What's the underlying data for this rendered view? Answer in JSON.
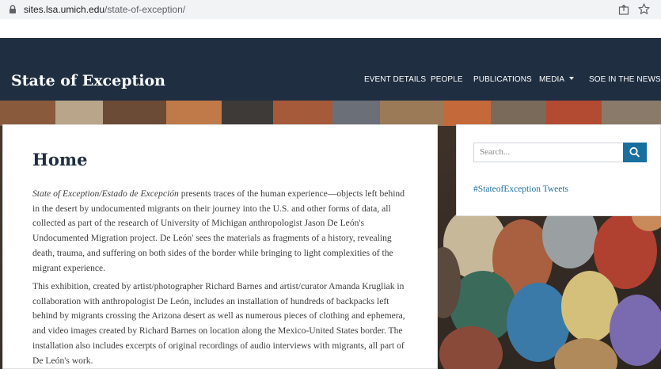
{
  "browser": {
    "url_host": "sites.lsa.umich.edu",
    "url_path": "/state-of-exception/"
  },
  "site": {
    "title": "State of Exception",
    "nav": [
      {
        "label": "EVENT DETAILS"
      },
      {
        "label": "PEOPLE"
      },
      {
        "label": "PUBLICATIONS"
      },
      {
        "label": "MEDIA"
      },
      {
        "label": "SOE IN THE NEWS"
      }
    ]
  },
  "main": {
    "title": "Home",
    "para1_italic": "State of Exception/Estado de Excepción",
    "para1_rest": " presents traces of the human experience—objects left behind in the desert by undocumented migrants on their journey into the U.S. and other forms of data, all collected as part of the research of University of Michigan anthropologist Jason De León's Undocumented Migration project.  De León' sees the materials as fragments of a history, revealing death, trauma, and suffering on both sides of the border while bringing to light complexities of the migrant experience.",
    "para2": "This exhibition, created by artist/photographer Richard Barnes and artist/curator Amanda Krugliak in collaboration with anthropologist De León, includes an installation of hundreds of backpacks left behind by migrants crossing the Arizona desert as well as numerous pieces of clothing and ephemera, and video images created by Richard Barnes on location along the Mexico-United States border. The installation also includes excerpts of original recordings of audio interviews with migrants, all part of De León's work."
  },
  "sidebar": {
    "search_placeholder": "Search...",
    "tweets_link": "#StateofException Tweets"
  },
  "colors": {
    "header_bg": "#1f2e40",
    "accent": "#1a6f9e",
    "link": "#1d6fa0"
  }
}
